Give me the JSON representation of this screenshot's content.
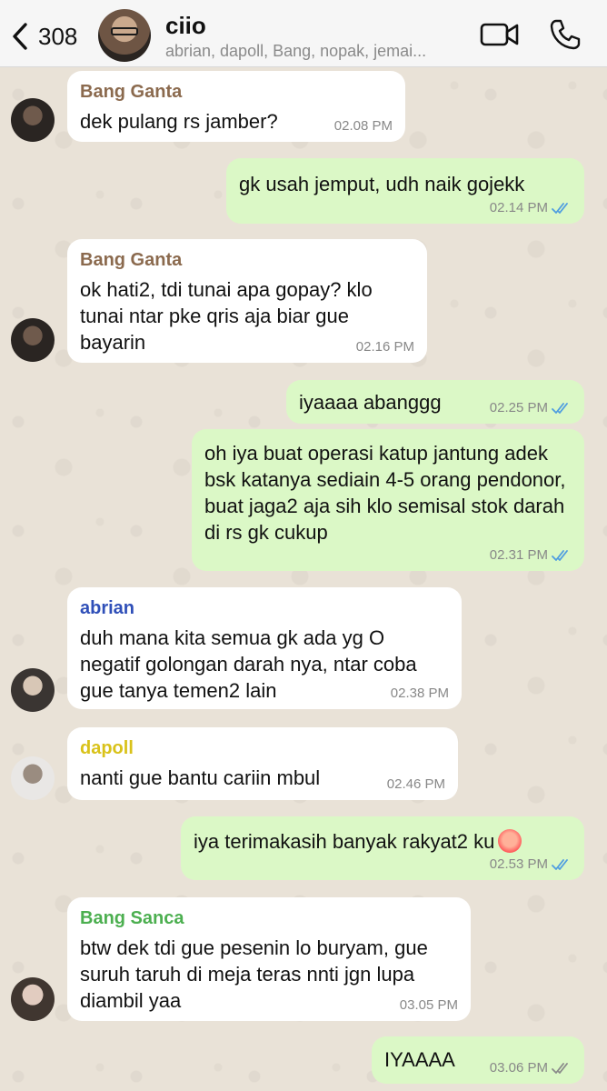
{
  "header": {
    "back_count": "308",
    "title": "ciio",
    "members": "abrian, dapoll, Bang, nopak, jemai..."
  },
  "messages": [
    {
      "sender": "Bang Ganta",
      "sender_color": "#8b6a4e",
      "text": "dek pulang rs jamber?",
      "time": "02.08 PM",
      "dir": "in"
    },
    {
      "text": "gk usah jemput, udh naik gojekk",
      "time": "02.14 PM",
      "dir": "out",
      "status": "read"
    },
    {
      "sender": "Bang Ganta",
      "sender_color": "#8b6a4e",
      "text": "ok hati2, tdi tunai apa gopay? klo tunai ntar pke qris aja biar gue bayarin",
      "time": "02.16 PM",
      "dir": "in"
    },
    {
      "text": "iyaaaa abanggg",
      "time": "02.25 PM",
      "dir": "out",
      "status": "read"
    },
    {
      "text": "oh iya buat operasi katup jantung adek bsk katanya sediain 4-5 orang pendonor, buat jaga2 aja sih klo semisal stok darah di rs gk cukup",
      "time": "02.31 PM",
      "dir": "out",
      "status": "read"
    },
    {
      "sender": "abrian",
      "sender_color": "#2f4fb8",
      "text": "duh mana kita semua gk ada yg O negatif golongan darah nya, ntar coba gue tanya temen2 lain",
      "time": "02.38 PM",
      "dir": "in"
    },
    {
      "sender": "dapoll",
      "sender_color": "#d9c21a",
      "text": "nanti gue bantu cariin mbul",
      "time": "02.46 PM",
      "dir": "in"
    },
    {
      "text": "iya terimakasih banyak rakyat2 ku",
      "emoji": "hot-face-emoji",
      "time": "02.53 PM",
      "dir": "out",
      "status": "read"
    },
    {
      "sender": "Bang Sanca",
      "sender_color": "#4caf50",
      "text": "btw dek tdi gue pesenin lo buryam, gue suruh taruh di meja teras nnti jgn lupa diambil yaa",
      "time": "03.05 PM",
      "dir": "in"
    },
    {
      "text": "IYAAAA",
      "time": "03.06 PM",
      "dir": "out",
      "status": "delivered"
    }
  ],
  "colors": {
    "outgoing_bubble": "#dbf8c6",
    "incoming_bubble": "#ffffff",
    "read_tick": "#4f9de0",
    "delivered_tick": "#8a8a8a"
  }
}
